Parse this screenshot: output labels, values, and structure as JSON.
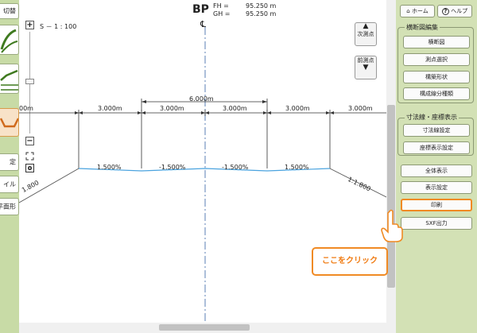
{
  "left_toolbar": {
    "items": [
      {
        "label": "切替"
      },
      {
        "label": "定"
      },
      {
        "label": "イル"
      },
      {
        "label": "平面形"
      }
    ]
  },
  "drawing": {
    "scale": "S － 1 : 100",
    "station": "BP",
    "centerline_symbol": "℄",
    "fh_label": "FH =",
    "fh_value": "95.250 m",
    "gh_label": "GH =",
    "gh_value": "95.250 m",
    "total_width": "6.000m",
    "segments": [
      "3.000m",
      "3.000m",
      "3.000m",
      "3.000m",
      "3.000m",
      "3.000m"
    ],
    "left_edge_dim": "00m",
    "slopes": [
      "1.500%",
      "-1.500%",
      "-1.500%",
      "1.500%"
    ],
    "left_fill": "1.800",
    "right_fill": "1:1.800"
  },
  "nav": {
    "next_label": "次測点",
    "prev_label": "前測点"
  },
  "right_panel": {
    "home": "ホーム",
    "help": "ヘルプ",
    "cross_section_group": "横断図編集",
    "cross_section_btn": "横断図",
    "point_select_btn": "測点選択",
    "structure_shape_btn": "構築形状",
    "component_line_btn": "構成線分種類",
    "dimension_group": "寸法線・座標表示",
    "dimension_setting_btn": "寸法線設定",
    "coord_display_btn": "座標表示設定",
    "full_display_btn": "全体表示",
    "display_setting_btn": "表示設定",
    "print_btn": "印刷",
    "sxf_output_btn": "SXF出力"
  },
  "callout": {
    "text": "ここをクリック"
  },
  "colors": {
    "panel_bg": "#d3e1b5",
    "accent_orange": "#f08a24",
    "water_line": "#4aa3df",
    "centerline": "#5b7fb5"
  }
}
